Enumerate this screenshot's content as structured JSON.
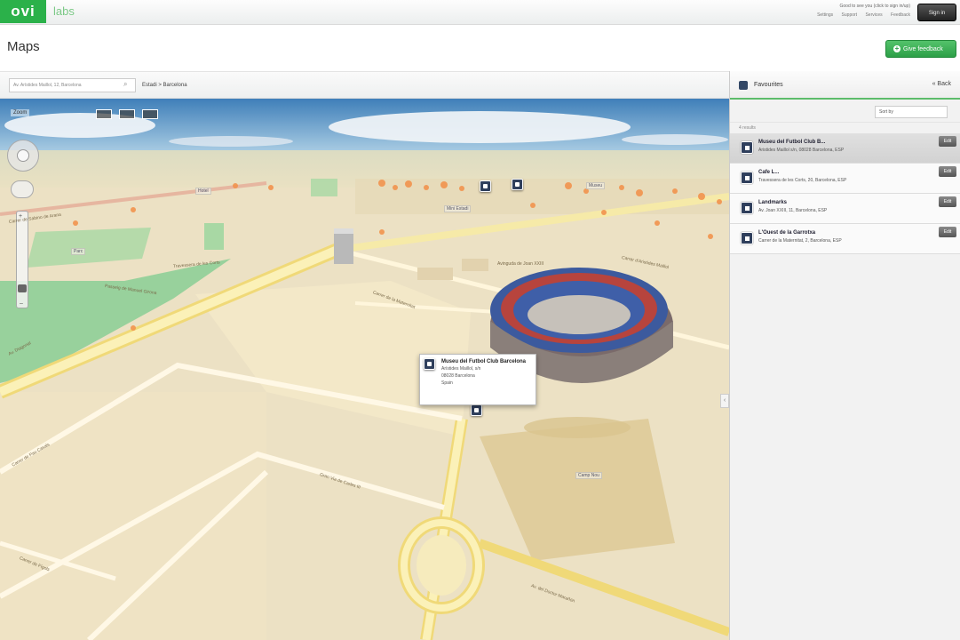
{
  "app": {
    "logo": "ovi",
    "labs": "labs"
  },
  "header": {
    "signin_text": "Good to see you (click to sign in/up)",
    "links": [
      "Settings",
      "Support",
      "Services",
      "Feedback"
    ],
    "signin_button": "Sign in"
  },
  "page": {
    "title": "Maps",
    "feedback_button": "Give feedback"
  },
  "search": {
    "value": "Av. Arístides Maillol, 12, Barcelona",
    "breadcrumb": "Estadi > Barcelona"
  },
  "map": {
    "zoom_label": "Zoom",
    "streets": [
      "Carrer de Sabino de Arana",
      "Travessera de les Corts",
      "Passeig de Manuel Girona",
      "Carrer de la Maternitat",
      "Avinguda de Joan XXIII",
      "Carrer d'Aristides Maillol",
      "Av. Diagonal",
      "Gran Via de Carles III",
      "Carrer de Pau Casals",
      "Av. del Doctor Marañón",
      "Carrer de Fígols"
    ],
    "pois": [
      "Camp Nou",
      "Mini Estadi",
      "Hotel",
      "Parc",
      "Museu"
    ],
    "callout": {
      "title": "Museu del Futbol Club Barcelona",
      "address": [
        "Arístides Maillol, s/n",
        "08028 Barcelona",
        "Spain"
      ]
    }
  },
  "sidebar": {
    "title": "Favourites",
    "back": "« Back",
    "sort_label": "Sort by",
    "count": "4 results",
    "results": [
      {
        "title": "Museu del Futbol Club B...",
        "address": "Aristides Maillol s/n, 08028 Barcelona, ESP",
        "button": "Edit",
        "active": true
      },
      {
        "title": "Cafe L...",
        "address": "Travessera de les Corts, 20, Barcelona, ESP",
        "button": "Edit",
        "active": false
      },
      {
        "title": "Landmarks",
        "address": "Av. Joan XXIII, 11, Barcelona, ESP",
        "button": "Edit",
        "active": false
      },
      {
        "title": "L'Ouest de la Garrotxa",
        "address": "Carrer de la Maternitat, 2, Barcelona, ESP",
        "button": "Edit",
        "active": false
      }
    ]
  },
  "colors": {
    "brand": "#2bb14a",
    "accent_bar": "#5cbc6a",
    "pin": "#2f3f5c"
  }
}
